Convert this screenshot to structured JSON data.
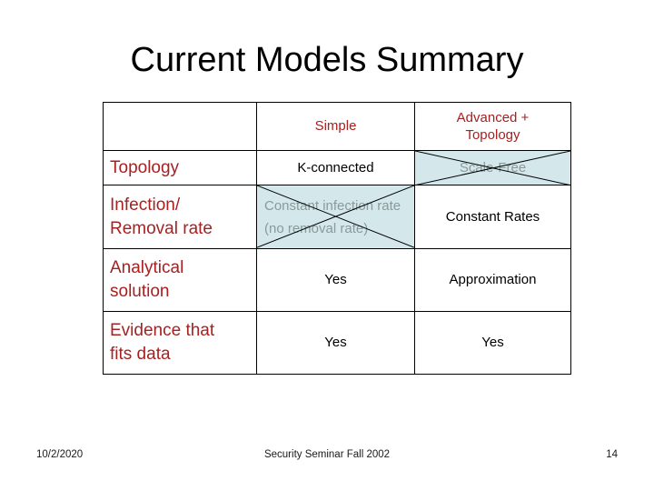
{
  "slide": {
    "title": "Current Models Summary"
  },
  "table": {
    "corner_label": "",
    "column_headers": [
      "",
      "Simple",
      "Advanced +\nTopology"
    ],
    "column_headers_flat": {
      "simple": "Simple",
      "advanced_line1": "Advanced +",
      "advanced_line2": "Topology"
    },
    "rows": [
      {
        "label": "Topology",
        "label_lines": [
          "Topology"
        ],
        "simple": {
          "text": "K-connected",
          "crossed_out": false,
          "highlighted": false
        },
        "advanced": {
          "text": "Scale-Free",
          "crossed_out": true,
          "highlighted": true
        }
      },
      {
        "label": "Infection/ Removal rate",
        "label_lines": [
          "Infection/",
          "Removal rate"
        ],
        "simple": {
          "text": "Constant infection rate (no removal rate)",
          "crossed_out": true,
          "highlighted": true
        },
        "advanced": {
          "text": "Constant Rates",
          "crossed_out": false,
          "highlighted": false
        }
      },
      {
        "label": "Analytical solution",
        "label_lines": [
          "Analytical",
          "solution"
        ],
        "simple": {
          "text": "Yes",
          "crossed_out": false,
          "highlighted": false
        },
        "advanced": {
          "text": "Approximation",
          "crossed_out": false,
          "highlighted": false
        }
      },
      {
        "label": "Evidence that fits data",
        "label_lines": [
          "Evidence that",
          "fits data"
        ],
        "simple": {
          "text": "Yes",
          "crossed_out": false,
          "highlighted": false
        },
        "advanced": {
          "text": "Yes",
          "crossed_out": false,
          "highlighted": false
        }
      }
    ]
  },
  "footer": {
    "date": "10/2/2020",
    "center": "Security Seminar Fall 2002",
    "page_number": "14"
  },
  "colors": {
    "label_red": "#a82020",
    "header_red": "#a82020",
    "value_black": "#000000",
    "crossed_text_gray": "#8a9a9a",
    "highlight_blue": "#d4e8ec",
    "title_black": "#000000"
  }
}
